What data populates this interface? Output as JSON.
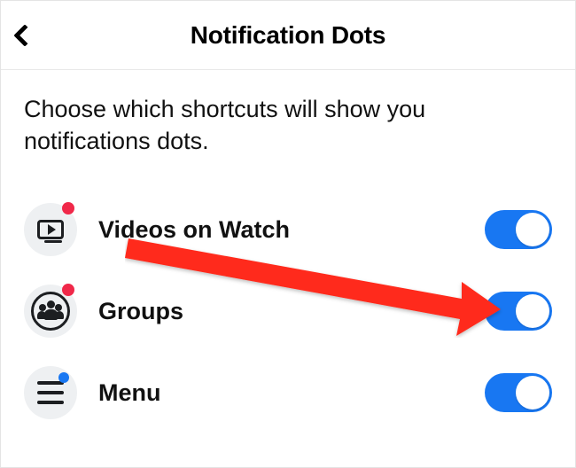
{
  "header": {
    "title": "Notification Dots"
  },
  "description": "Choose which shortcuts will show you notifications dots.",
  "items": [
    {
      "label": "Videos on Watch",
      "enabled": true,
      "dot": "red"
    },
    {
      "label": "Groups",
      "enabled": true,
      "dot": "red"
    },
    {
      "label": "Menu",
      "enabled": true,
      "dot": "blue"
    }
  ],
  "colors": {
    "accent": "#1877f2",
    "notif_red": "#f02849"
  }
}
